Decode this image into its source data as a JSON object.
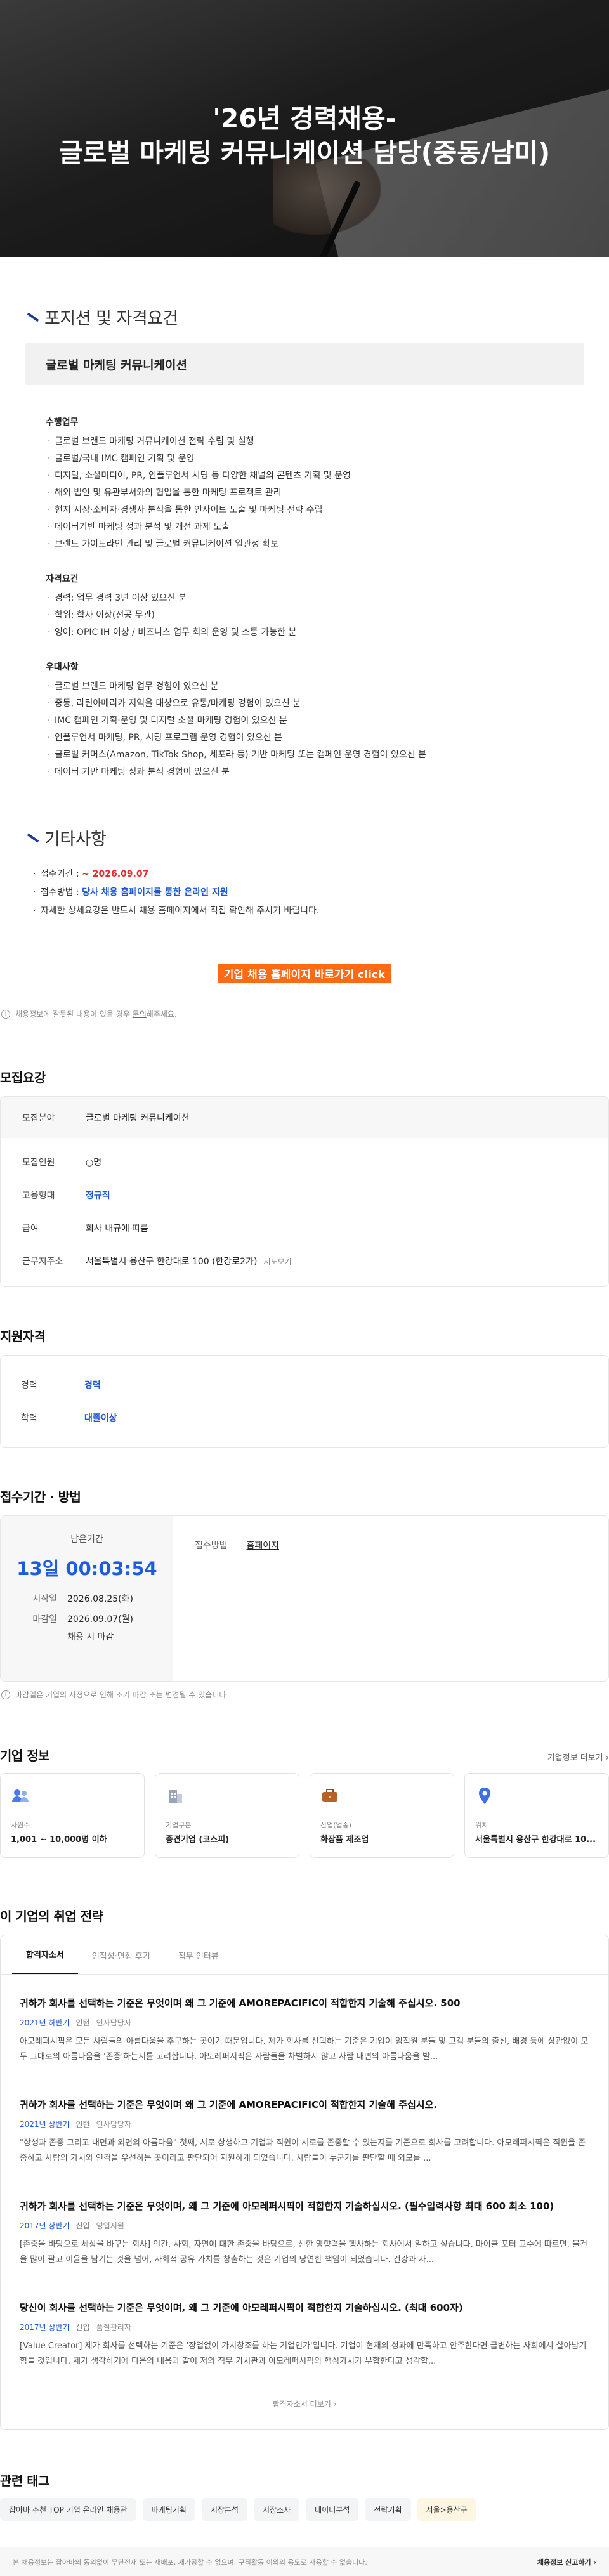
{
  "hero": {
    "title_line1": "'26년 경력채용-",
    "title_line2": "글로벌 마케팅 커뮤니케이션 담당(중동/남미)"
  },
  "position": {
    "section_title": "포지션 및 자격요건",
    "name": "글로벌 마케팅 커뮤니케이션",
    "duties_title": "수행업무",
    "duties": [
      "글로벌 브랜드 마케팅 커뮤니케이션 전략 수립 및 실행",
      "글로벌/국내 IMC 캠페인 기획 및 운영",
      "디지털, 소셜미디어, PR, 인플루언서 시딩 등 다양한 채널의 콘텐츠 기획 및 운영",
      "해외 법인 및 유관부서와의 협업을 통한 마케팅 프로젝트 관리",
      "현지 시장·소비자·경쟁사 분석을 통한 인사이트 도출 및 마케팅 전략 수립",
      "데이터기반 마케팅 성과 분석 및 개선 과제 도출",
      "브랜드 가이드라인 관리 및 글로벌 커뮤니케이션 일관성 확보"
    ],
    "qual_title": "자격요건",
    "quals": [
      "경력: 업무 경력 3년 이상 있으신 분",
      "학위: 학사 이상(전공 무관)",
      "영어: OPIC IH 이상 / 비즈니스 업무 회의 운영 및 소통 가능한 분"
    ],
    "pref_title": "우대사항",
    "prefs": [
      "글로벌 브랜드 마케팅 업무 경험이 있으신 분",
      "중동, 라틴아메리카 지역을 대상으로 유통/마케팅 경험이 있으신 분",
      "IMC 캠페인 기획·운영 및 디지털 소셜 마케팅 경험이 있으신 분",
      "인플루언서 마케팅, PR, 시딩 프로그램 운영 경험이 있으신 분",
      "글로벌 커머스(Amazon, TikTok Shop, 세포라 등) 기반 마케팅 또는 캠페인 운영 경험이 있으신 분",
      "데이터 기반 마케팅 성과 분석 경험이 있으신 분"
    ]
  },
  "etc": {
    "section_title": "기타사항",
    "deadline_label": "접수기간 : ",
    "deadline_value": "~ 2026.09.07",
    "method_label": "접수방법 : ",
    "method_value": "당사 채용 홈페이지를 통한 온라인 지원",
    "detail_text": "자세한 상세요강은 반드시 채용 홈페이지에서 직접 확인해 주시기 바랍니다.",
    "apply_button": "기업 채용 홈페이지 바로가기 click"
  },
  "notice": {
    "text_before": "채용정보에 잘못된 내용이 있을 경우 ",
    "link": "문의",
    "text_after": "해주세요."
  },
  "recruit": {
    "title": "모집요강",
    "field_key": "모집분야",
    "field_val": "글로벌 마케팅 커뮤니케이션",
    "count_key": "모집인원",
    "count_val": "○명",
    "type_key": "고용형태",
    "type_val": "정규직",
    "salary_key": "급여",
    "salary_val": "회사 내규에 따름",
    "location_key": "근무지주소",
    "location_val": "서울특별시 용산구 한강대로 100 (한강로2가)",
    "map_link": "지도보기"
  },
  "qualifications": {
    "title": "지원자격",
    "career_key": "경력",
    "career_val": "경력",
    "edu_key": "학력",
    "edu_val": "대졸이상"
  },
  "period": {
    "title": "접수기간 · 방법",
    "remain_label": "남은기간",
    "remain_time": "13일 00:03:54",
    "start_key": "시작일",
    "start_val": "2026.08.25(화)",
    "end_key": "마감일",
    "end_val": "2026.09.07(월)",
    "end_note": "채용 시 마감",
    "method_key": "접수방법",
    "method_val": "홈페이지",
    "footnote": "마감일은 기업의 사정으로 인해 조기 마감 또는 변경될 수 있습니다"
  },
  "company": {
    "title": "기업 정보",
    "more": "기업정보 더보기 ›",
    "cards": [
      {
        "label": "사원수",
        "value": "1,001 ~ 10,000명 이하",
        "icon": "people-icon"
      },
      {
        "label": "기업구분",
        "value": "중견기업 (코스피)",
        "icon": "building-icon"
      },
      {
        "label": "산업(업종)",
        "value": "화장품 제조업",
        "icon": "briefcase-icon"
      },
      {
        "label": "위치",
        "value": "서울특별시 용산구 한강대로 10...",
        "icon": "location-pin-icon"
      }
    ]
  },
  "strategy": {
    "title": "이 기업의 취업 전략",
    "tabs": [
      "합격자소서",
      "인적성·면접 후기",
      "직무 인터뷰"
    ],
    "items": [
      {
        "q": "귀하가 회사를 선택하는 기준은 무엇이며 왜 그 기준에 AMOREPACIFIC이 적합한지 기술해 주십시오. 500",
        "year": "2021년 하반기",
        "kind": "인턴",
        "job": "인사담당자",
        "a": "아모레퍼시픽은 모든 사람들의 아름다움을 추구하는 곳이기 때문입니다. 제가 회사를 선택하는 기준은 기업이 임직원 분들 및 고객 분들의 출신, 배경 등에 상관없이 모두 그대로의 아름다움을 '존중'하는지를 고려합니다. 아모레퍼시픽은 사람들을 차별하지 않고 사람 내면의 아름다움을 발..."
      },
      {
        "q": "귀하가 회사를 선택하는 기준은 무엇이며 왜 그 기준에 AMOREPACIFIC이 적합한지 기술해 주십시오.",
        "year": "2021년 상반기",
        "kind": "인턴",
        "job": "인사담당자",
        "a": "\"상생과 존중 그리고 내면과 외면의 아름다움\" 첫째, 서로 상생하고 기업과 직원이 서로를 존중할 수 있는지를 기준으로 회사를 고려합니다. 아모레퍼시픽은 직원을 존중하고 사람의 가치와 인격을 우선하는 곳이라고 판단되어 지원하게 되었습니다. 사람들이 누군가를 판단할 때 외모를 ..."
      },
      {
        "q": "귀하가 회사를 선택하는 기준은 무엇이며, 왜 그 기준에 아모레퍼시픽이 적합한지 기술하십시오. (필수입력사항 최대 600 최소 100)",
        "year": "2017년 상반기",
        "kind": "신입",
        "job": "영업지원",
        "a": "[존중을 바탕으로 세상을 바꾸는 회사] 인간, 사회, 자연에 대한 존중을 바탕으로, 선한 영향력을 행사하는 회사에서 일하고 싶습니다. 마이클 포터 교수에 따르면, 물건을 많이 팔고 이윤을 남기는 것을 넘어, 사회적 공유 가치를 창출하는 것은 기업의 당연한 책임이 되었습니다. 건강과 자..."
      },
      {
        "q": "당신이 회사를 선택하는 기준은 무엇이며, 왜 그 기준에 아모레퍼시픽이 적합한지 기술하십시오. (최대 600자)",
        "year": "2017년 상반기",
        "kind": "신입",
        "job": "품질관리자",
        "a": "[Value Creator] 제가 회사를 선택하는 기준은 '장업없이 가치창조를 하는 기업인가'입니다. 기업이 현재의 성과에 만족하고 안주한다면 급변하는 사회에서 살아남기 힘들 것입니다. 제가 생각하기에 다음의 내용과 같이 저의 직무 가치관과 아모레퍼시픽의 핵심가치가 부합한다고 생각합..."
      }
    ],
    "more": "합격자소서 더보기 ›"
  },
  "tags": {
    "title": "관련 태그",
    "items": [
      "잡아바 추천 TOP 기업 온라인 채용관",
      "마케팅기획",
      "시장분석",
      "시장조사",
      "데이터분석",
      "전략기획",
      "서울>용산구"
    ]
  },
  "footer": {
    "text": "본 채용정보는 잡아바의 동의없이 무단전재 또는 재배포, 재가공할 수 없으며, 구직활동 이외의 용도로 사용할 수 없습니다.",
    "report": "채용정보 신고하기 ›"
  },
  "colors": {
    "accent_blue": "#1f56d4",
    "deadline_red": "#e52b2b",
    "apply_orange": "#ff6a13"
  }
}
